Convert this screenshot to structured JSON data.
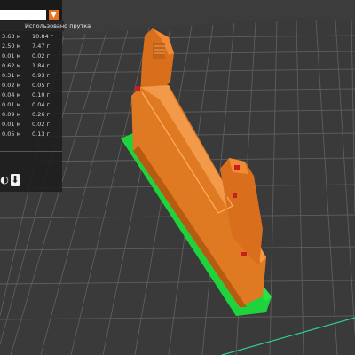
{
  "app": {
    "accent_color": "#e8731f",
    "model_color": "#e07a22",
    "support_color": "#20d040"
  },
  "stats_panel": {
    "col_length_header": "",
    "col_weight_header": "Использовано прутка",
    "rows": [
      {
        "length": "3.63 м",
        "weight": "10.84 г"
      },
      {
        "length": "2.50 м",
        "weight": "7.47 г"
      },
      {
        "length": "0.01 м",
        "weight": "0.02 г"
      },
      {
        "length": "0.62 м",
        "weight": "1.84 г"
      },
      {
        "length": "0.31 м",
        "weight": "0.93 г"
      },
      {
        "length": "0.02 м",
        "weight": "0.05 г"
      },
      {
        "length": "0.04 м",
        "weight": "0.10 г"
      },
      {
        "length": "0.01 м",
        "weight": "0.04 г"
      },
      {
        "length": "0.09 м",
        "weight": "0.26 г"
      },
      {
        "length": "0.01 м",
        "weight": "0.02 г"
      },
      {
        "length": "0.05 м",
        "weight": "0.13 г"
      }
    ],
    "icons": [
      "dropdown-arrow-icon",
      "export-icon",
      "download-icon"
    ]
  }
}
